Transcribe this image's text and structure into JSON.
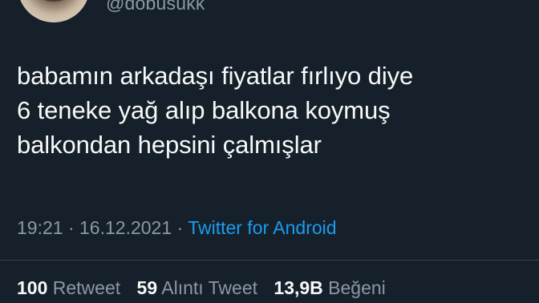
{
  "author": {
    "handle": "@dobusukk"
  },
  "tweet": {
    "lines": [
      "babamın arkadaşı fiyatlar fırlıyo diye",
      "6 teneke yağ alıp balkona koymuş",
      "balkondan hepsini çalmışlar"
    ],
    "time": "19:21",
    "date": "16.12.2021",
    "separator": "·",
    "source": "Twitter for Android"
  },
  "stats": {
    "retweets": {
      "count": "100",
      "label": "Retweet"
    },
    "quotes": {
      "count": "59",
      "label": "Alıntı Tweet"
    },
    "likes": {
      "count": "13,9B",
      "label": "Beğeni"
    }
  },
  "colors": {
    "background": "#15202b",
    "text": "#f7f9f9",
    "muted": "#8b98a5",
    "link": "#1d9bf0",
    "divider": "#38444d"
  }
}
